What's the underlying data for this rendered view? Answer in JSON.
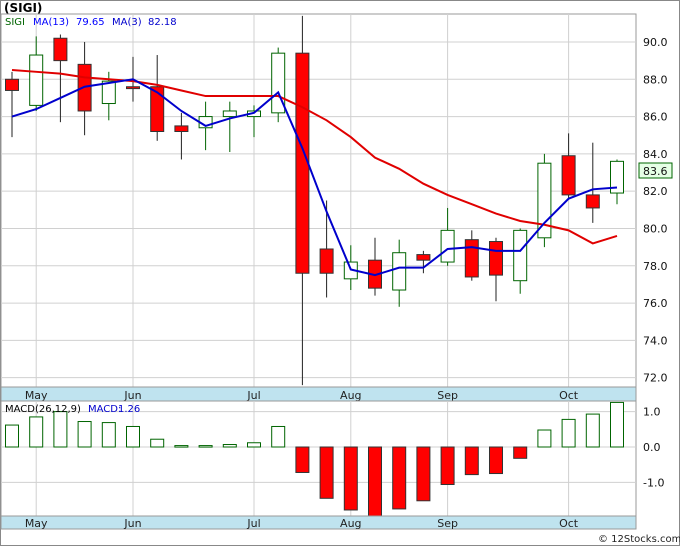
{
  "title": "(SIGI)",
  "credit": "© 12Stocks.com",
  "chart_data": [
    {
      "type": "candlestick",
      "legend": {
        "symbol": "SIGI",
        "ma13_label": "MA(13)",
        "ma13_value": "79.65",
        "ma3_label": "MA(3)",
        "ma3_value": "82.18",
        "ma13_color": "#0000ff",
        "ma3_color": "#0000cc"
      },
      "ylim": [
        71.5,
        91.5
      ],
      "yticks": [
        "72.0",
        "74.0",
        "76.0",
        "78.0",
        "80.0",
        "82.0",
        "84.0",
        "86.0",
        "88.0",
        "90.0"
      ],
      "last_price": "83.6",
      "up_color": "#ffffff",
      "up_border": "#006400",
      "down_color": "#ff0000",
      "months": [
        {
          "label": "May",
          "index": 1
        },
        {
          "label": "Jun",
          "index": 5
        },
        {
          "label": "Jul",
          "index": 10
        },
        {
          "label": "Aug",
          "index": 14
        },
        {
          "label": "Sep",
          "index": 18
        },
        {
          "label": "Oct",
          "index": 23
        }
      ],
      "candles": [
        {
          "o": 88.0,
          "h": 88.4,
          "l": 84.9,
          "c": 87.4
        },
        {
          "o": 86.6,
          "h": 90.3,
          "l": 86.3,
          "c": 89.3
        },
        {
          "o": 90.2,
          "h": 90.4,
          "l": 85.7,
          "c": 89.0
        },
        {
          "o": 88.8,
          "h": 90.0,
          "l": 85.0,
          "c": 86.3
        },
        {
          "o": 86.7,
          "h": 88.4,
          "l": 85.8,
          "c": 87.9
        },
        {
          "o": 87.6,
          "h": 89.2,
          "l": 86.8,
          "c": 87.5
        },
        {
          "o": 87.6,
          "h": 89.3,
          "l": 84.7,
          "c": 85.2
        },
        {
          "o": 85.5,
          "h": 86.2,
          "l": 83.7,
          "c": 85.2
        },
        {
          "o": 85.4,
          "h": 86.8,
          "l": 84.2,
          "c": 86.0
        },
        {
          "o": 86.0,
          "h": 86.8,
          "l": 84.1,
          "c": 86.3
        },
        {
          "o": 86.0,
          "h": 86.6,
          "l": 84.9,
          "c": 86.3
        },
        {
          "o": 86.2,
          "h": 89.7,
          "l": 85.7,
          "c": 89.4
        },
        {
          "o": 89.4,
          "h": 91.4,
          "l": 71.6,
          "c": 77.6
        },
        {
          "o": 78.9,
          "h": 81.5,
          "l": 76.3,
          "c": 77.6
        },
        {
          "o": 77.3,
          "h": 79.1,
          "l": 76.7,
          "c": 78.2
        },
        {
          "o": 78.3,
          "h": 79.5,
          "l": 76.4,
          "c": 76.8
        },
        {
          "o": 76.7,
          "h": 79.4,
          "l": 75.8,
          "c": 78.7
        },
        {
          "o": 78.6,
          "h": 78.8,
          "l": 77.6,
          "c": 78.3
        },
        {
          "o": 78.2,
          "h": 81.1,
          "l": 78.0,
          "c": 79.9
        },
        {
          "o": 79.4,
          "h": 79.9,
          "l": 77.2,
          "c": 77.4
        },
        {
          "o": 79.3,
          "h": 79.5,
          "l": 76.1,
          "c": 77.5
        },
        {
          "o": 77.2,
          "h": 80.0,
          "l": 76.5,
          "c": 79.9
        },
        {
          "o": 79.5,
          "h": 84.0,
          "l": 79.0,
          "c": 83.5
        },
        {
          "o": 83.9,
          "h": 85.1,
          "l": 81.6,
          "c": 81.8
        },
        {
          "o": 81.8,
          "h": 84.6,
          "l": 80.3,
          "c": 81.1
        },
        {
          "o": 81.9,
          "h": 83.7,
          "l": 81.3,
          "c": 83.6
        }
      ],
      "ma_red": [
        88.5,
        88.4,
        88.3,
        88.1,
        88.0,
        87.9,
        87.7,
        87.4,
        87.1,
        87.1,
        87.1,
        87.1,
        86.5,
        85.8,
        84.9,
        83.8,
        83.2,
        82.4,
        81.8,
        81.3,
        80.8,
        80.4,
        80.2,
        79.9,
        79.2,
        79.6
      ],
      "ma_blue": [
        86.0,
        86.4,
        87.0,
        87.6,
        87.8,
        88.0,
        87.3,
        86.3,
        85.5,
        85.9,
        86.2,
        87.3,
        84.3,
        80.9,
        77.8,
        77.5,
        77.9,
        77.9,
        78.9,
        79.0,
        78.8,
        78.8,
        80.3,
        81.6,
        82.1,
        82.2
      ]
    },
    {
      "type": "bar",
      "legend": {
        "label": "MACD(26,12,9)",
        "macd_label": "MACD:",
        "macd_value": "1.26",
        "color": "#0000cc"
      },
      "ylim": [
        -1.95,
        1.3
      ],
      "yticks": [
        "1.0",
        "0.0",
        "-1.0"
      ],
      "pos_color": "#ffffff",
      "pos_border": "#006400",
      "neg_color": "#ff0000",
      "months": [
        {
          "label": "May",
          "index": 1
        },
        {
          "label": "Jun",
          "index": 5
        },
        {
          "label": "Jul",
          "index": 10
        },
        {
          "label": "Aug",
          "index": 14
        },
        {
          "label": "Sep",
          "index": 18
        },
        {
          "label": "Oct",
          "index": 23
        }
      ],
      "values": [
        0.62,
        0.85,
        1.0,
        0.72,
        0.69,
        0.58,
        0.22,
        0.04,
        0.04,
        0.07,
        0.12,
        0.58,
        -0.72,
        -1.45,
        -1.78,
        -1.98,
        -1.75,
        -1.52,
        -1.06,
        -0.78,
        -0.75,
        -0.32,
        0.48,
        0.78,
        0.93,
        1.26
      ]
    }
  ]
}
